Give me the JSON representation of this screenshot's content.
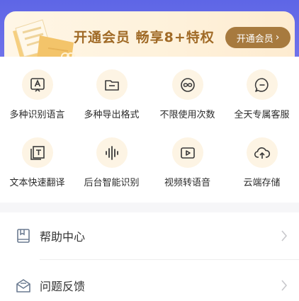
{
  "vip": {
    "title": "开通会员 畅享8+特权",
    "button_label": "开通会员",
    "accent": "#a77a3e",
    "title_color": "#a06a26"
  },
  "features": [
    {
      "label": "多种识别语言",
      "icon": "translate-a-icon"
    },
    {
      "label": "多种导出格式",
      "icon": "folder-icon"
    },
    {
      "label": "不限使用次数",
      "icon": "infinity-icon"
    },
    {
      "label": "全天专属客服",
      "icon": "chat-bubble-icon"
    },
    {
      "label": "文本快速翻译",
      "icon": "text-t-icon"
    },
    {
      "label": "后台智能识别",
      "icon": "audio-wave-icon"
    },
    {
      "label": "视频转语音",
      "icon": "video-play-icon"
    },
    {
      "label": "云端存储",
      "icon": "cloud-upload-icon"
    }
  ],
  "menu": {
    "help_label": "帮助中心",
    "feedback_label": "问题反馈"
  }
}
